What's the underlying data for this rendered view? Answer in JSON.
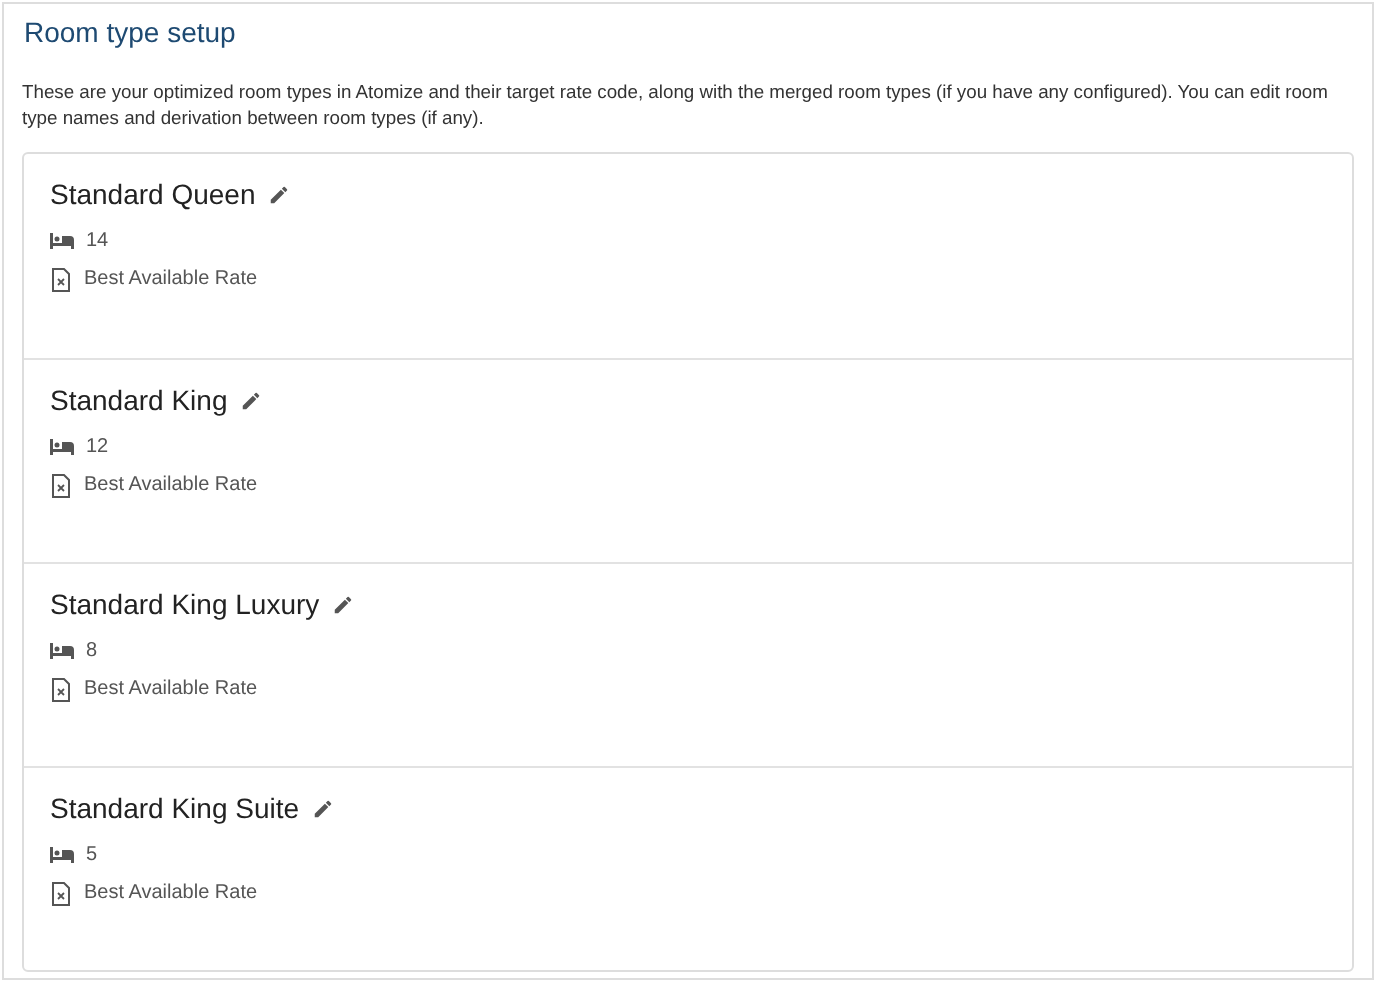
{
  "title": "Room type setup",
  "description": "These are your optimized room types in Atomize and their target rate code, along with the merged room types (if you have any configured). You can edit room type names and derivation between room types (if any).",
  "rooms": [
    {
      "name": "Standard Queen",
      "count": "14",
      "rate": "Best Available Rate"
    },
    {
      "name": "Standard King",
      "count": "12",
      "rate": "Best Available Rate"
    },
    {
      "name": "Standard King Luxury",
      "count": "8",
      "rate": "Best Available Rate"
    },
    {
      "name": "Standard King Suite",
      "count": "5",
      "rate": "Best Available Rate"
    }
  ]
}
